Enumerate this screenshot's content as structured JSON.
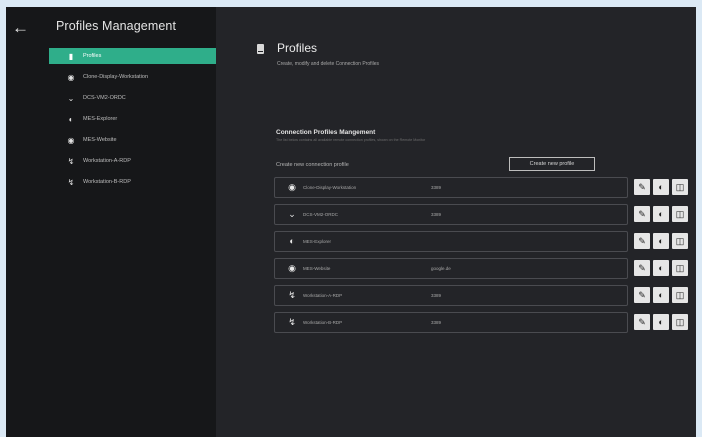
{
  "app": {
    "title": "Profiles Management"
  },
  "sidebar": {
    "items": [
      {
        "label": "Profiles",
        "icon": "document-icon",
        "active": true
      },
      {
        "label": "Clone-Display-Workstation",
        "icon": "eye-icon"
      },
      {
        "label": "DCS-VM2-ORDC",
        "icon": "chevron-down-icon"
      },
      {
        "label": "MES-Explorer",
        "icon": "edge-icon"
      },
      {
        "label": "MES-Website",
        "icon": "globe-icon"
      },
      {
        "label": "Workstation-A-RDP",
        "icon": "lightning-icon"
      },
      {
        "label": "Workstation-B-RDP",
        "icon": "lightning-icon"
      }
    ]
  },
  "page": {
    "title": "Profiles",
    "subtitle": "Create, modify and delete Connection Profiles"
  },
  "section": {
    "title": "Connection Profiles Mangement",
    "description": "The list below contains all available remote connection profiles, shown on the Remote Monitor",
    "create_label": "Create new connection profile",
    "create_button": "Create new profile"
  },
  "profiles": [
    {
      "name": "Clone-Display-Workstation",
      "value": "3389",
      "icon": "eye-icon"
    },
    {
      "name": "DCS-VM2-ORDC",
      "value": "3389",
      "icon": "chevron-down-icon"
    },
    {
      "name": "MES-Explorer",
      "value": "",
      "icon": "edge-icon"
    },
    {
      "name": "MES-Website",
      "value": "google.de",
      "icon": "globe-icon"
    },
    {
      "name": "Workstation-A-RDP",
      "value": "3389",
      "icon": "lightning-icon"
    },
    {
      "name": "Workstation-B-RDP",
      "value": "3389",
      "icon": "lightning-icon"
    }
  ],
  "colors": {
    "accent": "#2fae8a",
    "background": "#232428",
    "sidebar": "#161719"
  }
}
